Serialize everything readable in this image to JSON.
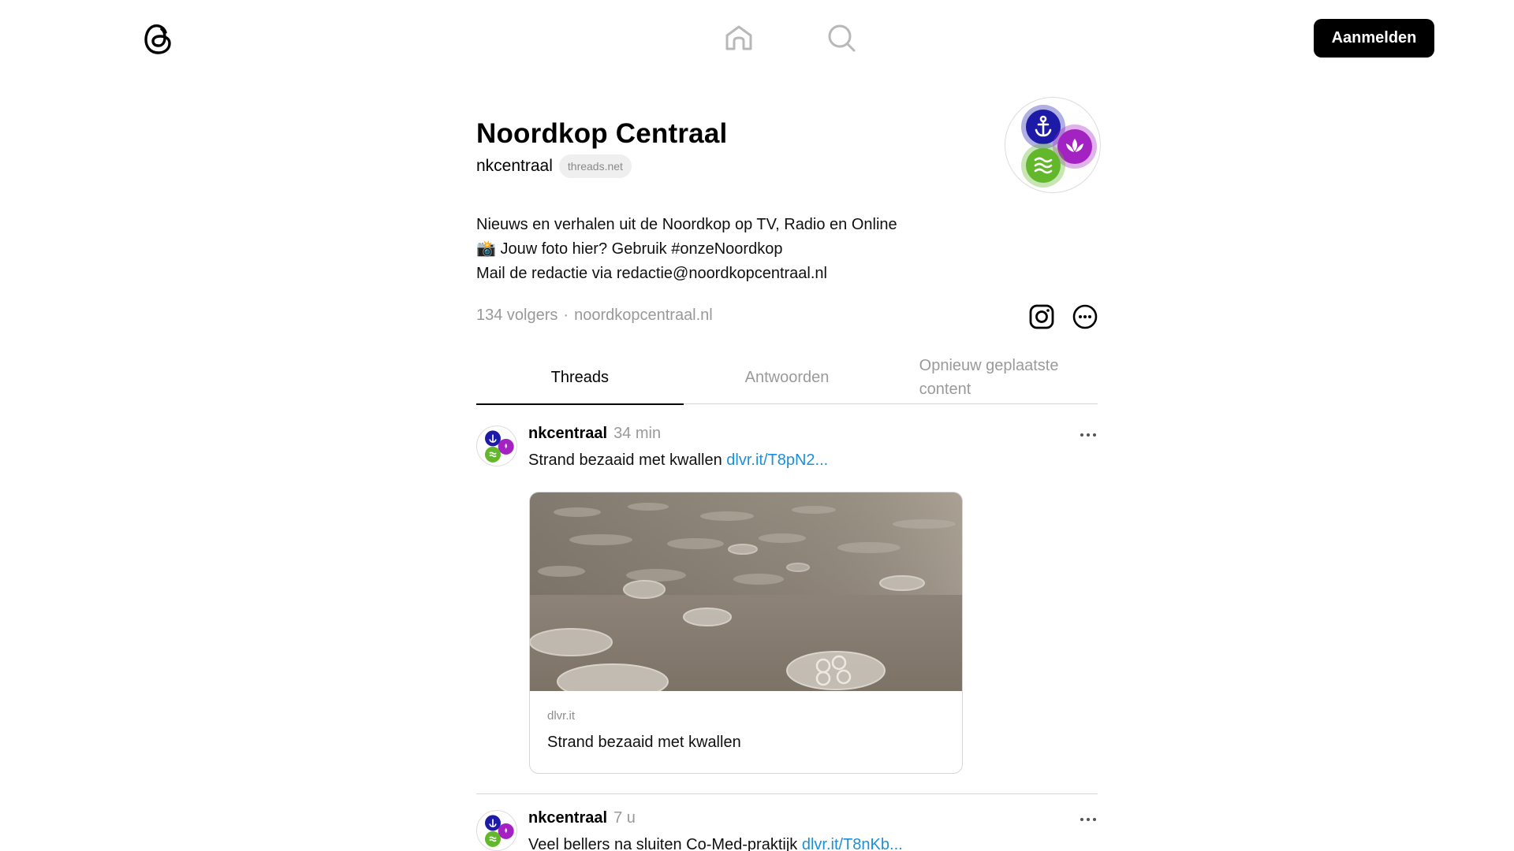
{
  "header": {
    "logo_icon": "threads-logo-icon",
    "nav": [
      {
        "icon": "home-icon"
      },
      {
        "icon": "search-icon"
      }
    ],
    "login_label": "Aanmelden"
  },
  "profile": {
    "name": "Noordkop Centraal",
    "handle": "nkcentraal",
    "domain_chip": "threads.net",
    "bio": [
      "Nieuws en verhalen uit de Noordkop op TV, Radio en Online",
      "📸 Jouw foto hier? Gebruik #onzeNoordkop",
      "Mail de redactie via redactie@noordkopcentraal.nl"
    ],
    "followers": "134 volgers",
    "separator": "·",
    "website": "noordkopcentraal.nl",
    "action_icons": [
      "instagram-icon",
      "more-icon"
    ],
    "avatar_colors": [
      "#1d1aa8",
      "#a322c2",
      "#62b82a"
    ]
  },
  "tabs": [
    {
      "label": "Threads",
      "active": true
    },
    {
      "label": "Antwoorden",
      "active": false
    },
    {
      "label": "Opnieuw geplaatste content",
      "active": false
    }
  ],
  "posts": [
    {
      "user": "nkcentraal",
      "time": "34 min",
      "text": "Strand bezaaid met kwallen",
      "link": "dlvr.it/T8pN2...",
      "card": {
        "domain": "dlvr.it",
        "title": "Strand bezaaid met kwallen"
      }
    },
    {
      "user": "nkcentraal",
      "time": "7 u",
      "text": "Veel bellers na sluiten Co-Med-praktijk",
      "link": "dlvr.it/T8nKb..."
    }
  ],
  "colors": {
    "link": "#1d8fd8",
    "muted": "#999999",
    "button_bg": "#000000"
  }
}
